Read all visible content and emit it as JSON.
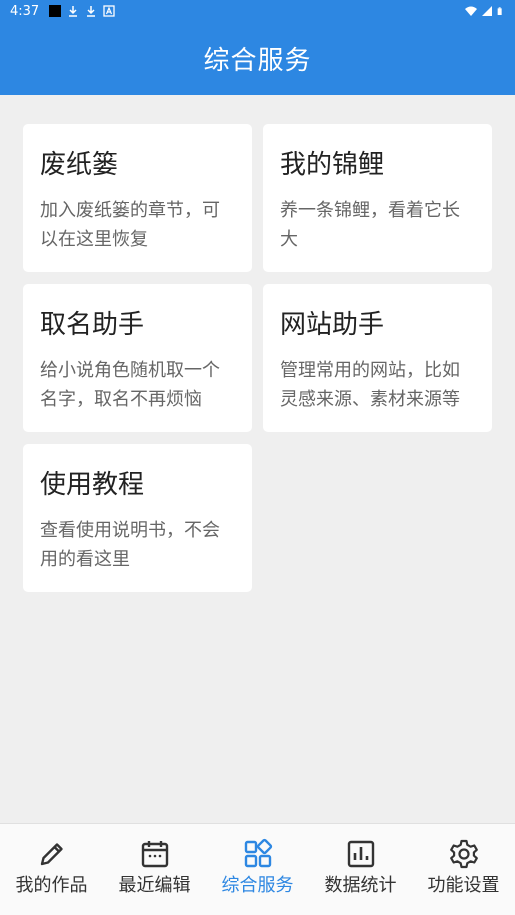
{
  "status_bar": {
    "time": "4:37"
  },
  "app_bar": {
    "title": "综合服务"
  },
  "cards": [
    {
      "title": "废纸篓",
      "desc": "加入废纸篓的章节，可以在这里恢复"
    },
    {
      "title": "我的锦鲤",
      "desc": "养一条锦鲤，看着它长大"
    },
    {
      "title": "取名助手",
      "desc": "给小说角色随机取一个名字，取名不再烦恼"
    },
    {
      "title": "网站助手",
      "desc": "管理常用的网站，比如灵感来源、素材来源等"
    },
    {
      "title": "使用教程",
      "desc": "查看使用说明书，不会用的看这里"
    }
  ],
  "bottom_nav": {
    "items": [
      {
        "label": "我的作品",
        "icon": "pencil-icon"
      },
      {
        "label": "最近编辑",
        "icon": "calendar-icon"
      },
      {
        "label": "综合服务",
        "icon": "grid-icon"
      },
      {
        "label": "数据统计",
        "icon": "bar-chart-icon"
      },
      {
        "label": "功能设置",
        "icon": "gear-icon"
      }
    ],
    "active_index": 2
  },
  "colors": {
    "primary": "#2d87e2",
    "background": "#efefef",
    "card": "#ffffff"
  }
}
